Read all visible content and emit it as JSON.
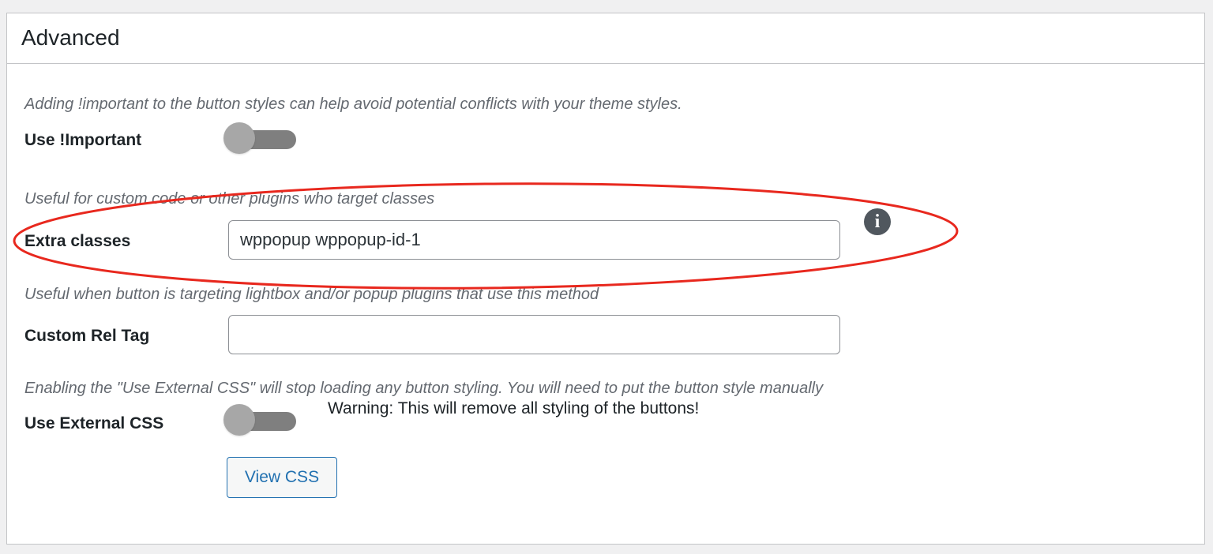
{
  "panel": {
    "title": "Advanced"
  },
  "settings": {
    "use_important": {
      "description": "Adding !important to the button styles can help avoid potential conflicts with your theme styles.",
      "label": "Use !Important",
      "enabled": false
    },
    "extra_classes": {
      "description": "Useful for custom code or other plugins who target classes",
      "label": "Extra classes",
      "value": "wppopup wppopup-id-1",
      "info_glyph": "i"
    },
    "custom_rel_tag": {
      "description": "Useful when button is targeting lightbox and/or popup plugins that use this method",
      "label": "Custom Rel Tag",
      "value": ""
    },
    "use_external_css": {
      "description": "Enabling the \"Use External CSS\" will stop loading any button styling. You will need to put the button style manually",
      "label": "Use External CSS",
      "enabled": false,
      "warning": "Warning: This will remove all styling of the buttons!"
    },
    "view_css_label": "View CSS"
  },
  "colors": {
    "accent": "#2271b1",
    "annotation": "#e8281e",
    "toggle_track": "#7f7f7f",
    "toggle_knob": "#a7a7a7"
  },
  "icons": {
    "info": "info-icon"
  }
}
